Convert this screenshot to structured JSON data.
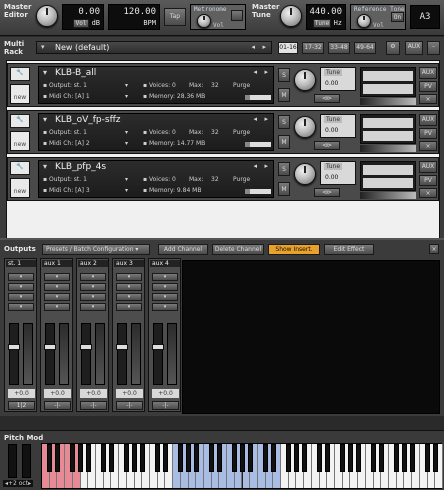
{
  "header": {
    "master_editor": "Master\nEditor",
    "volume_value": "0.00",
    "volume_btn": "Vol",
    "volume_unit": "dB",
    "bpm_value": "120.00",
    "bpm_unit": "BPM",
    "tap": "Tap",
    "metronome": "Metronome",
    "metronome_vol": "Vol",
    "master_tune": "Master\nTune",
    "tune_value": "440.00",
    "tune_btn": "Tune",
    "tune_unit": "Hz",
    "reference_tone": "Reference Tone",
    "ref_on": "On",
    "ref_vol": "Vol",
    "note": "A3"
  },
  "rack": {
    "title": "Multi\nRack",
    "multi_name": "New (default)",
    "pages": [
      "01-16",
      "17-32",
      "33-48",
      "49-64"
    ],
    "aux": "AUX",
    "instruments": [
      {
        "name": "KLB-B_all",
        "output_label": "Output:",
        "output": "st. 1",
        "voices_label": "Voices:",
        "voices": "0",
        "max_label": "Max:",
        "max": "32",
        "purge": "Purge",
        "midi_label": "Midi Ch:",
        "midi_port": "[A]",
        "midi_ch": "1",
        "memory_label": "Memory:",
        "memory": "28.36 MB",
        "tune_label": "Tune",
        "tune_value": "0.00",
        "s": "S",
        "m": "M",
        "new": "new",
        "pan": "⊲⊳",
        "aux": "AUX",
        "pv": "PV"
      },
      {
        "name": "KLB_oV_fp-sffz",
        "output_label": "Output:",
        "output": "st. 1",
        "voices_label": "Voices:",
        "voices": "0",
        "max_label": "Max:",
        "max": "32",
        "purge": "Purge",
        "midi_label": "Midi Ch:",
        "midi_port": "[A]",
        "midi_ch": "2",
        "memory_label": "Memory:",
        "memory": "14.77 MB",
        "tune_label": "Tune",
        "tune_value": "0.00",
        "s": "S",
        "m": "M",
        "new": "new",
        "pan": "⊲⊳",
        "aux": "AUX",
        "pv": "PV"
      },
      {
        "name": "KLB_pfp_4s",
        "output_label": "Output:",
        "output": "st. 1",
        "voices_label": "Voices:",
        "voices": "0",
        "max_label": "Max:",
        "max": "32",
        "purge": "Purge",
        "midi_label": "Midi Ch:",
        "midi_port": "[A]",
        "midi_ch": "3",
        "memory_label": "Memory:",
        "memory": "9.84 MB",
        "tune_label": "Tune",
        "tune_value": "0.00",
        "s": "S",
        "m": "M",
        "new": "new",
        "pan": "⊲⊳",
        "aux": "AUX",
        "pv": "PV"
      }
    ]
  },
  "outputs": {
    "title": "Outputs",
    "preset_menu": "Presets / Batch Configuration",
    "buttons": [
      "Add Channel",
      "Delete Channel",
      "Show Insert.",
      "Edit Effect"
    ],
    "channels": [
      {
        "name": "st. 1",
        "value": "+0.0",
        "bottom": "1|2"
      },
      {
        "name": "aux 1",
        "value": "+0.0",
        "bottom": "-|-"
      },
      {
        "name": "aux 2",
        "value": "+0.0",
        "bottom": "-|-"
      },
      {
        "name": "aux 3",
        "value": "+0.0",
        "bottom": "-|-"
      },
      {
        "name": "aux 4",
        "value": "+0.0",
        "bottom": "-|-"
      }
    ]
  },
  "keyboard": {
    "pitch_mod": "Pitch Mod",
    "octave": "◂+2 oct▸"
  },
  "colors": {
    "accent": "#e8a12a",
    "keyswitch": "#e78a96",
    "mapped": "#a9bce4"
  }
}
